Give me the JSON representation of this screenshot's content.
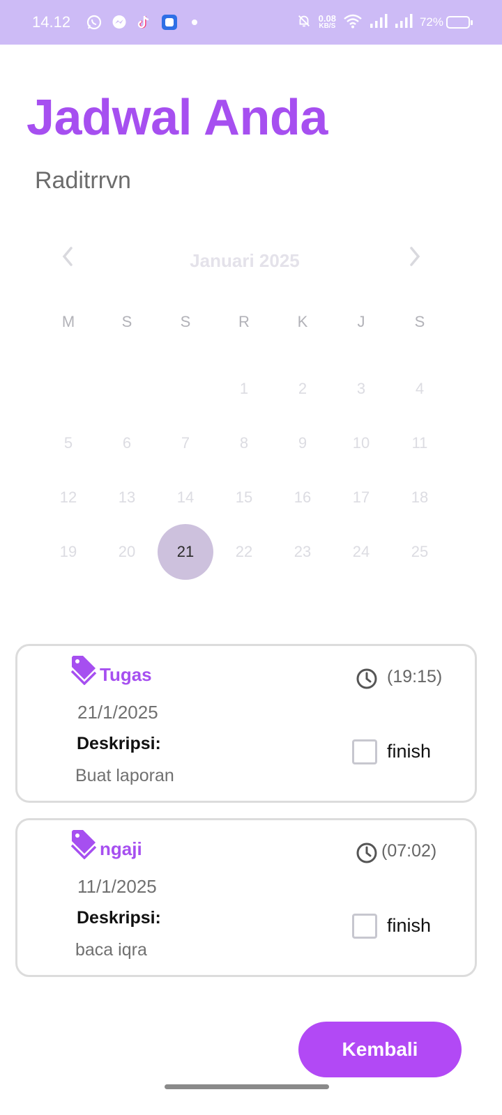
{
  "status_bar": {
    "time": "14.12",
    "app_icons": [
      "whatsapp-icon",
      "messenger-icon",
      "tiktok-icon",
      "app-icon",
      "dot-icon"
    ],
    "net_speed": "0.08",
    "net_unit": "KB/S",
    "battery": "72%",
    "battery_level": 0.72,
    "background": "#cdbbf6"
  },
  "header": {
    "title": "Jadwal Anda",
    "username": "Raditrrvn"
  },
  "calendar": {
    "month_label": "Januari 2025",
    "prev_icon": "chevron-left-icon",
    "next_icon": "chevron-right-icon",
    "weekdays": [
      "M",
      "S",
      "S",
      "R",
      "K",
      "J",
      "S"
    ],
    "leading_blanks": 3,
    "days": [
      "1",
      "2",
      "3",
      "4",
      "5",
      "6",
      "7",
      "8",
      "9",
      "10",
      "11",
      "12",
      "13",
      "14",
      "15",
      "16",
      "17",
      "18",
      "19",
      "20",
      "21",
      "22",
      "23",
      "24",
      "25"
    ],
    "selected_day": "21"
  },
  "schedules": [
    {
      "category": "Tugas",
      "date": "21/1/2025",
      "description_label": "Deskripsi:",
      "description": "Buat laporan",
      "time": "(19:15)",
      "finish_label": "finish",
      "finished": false
    },
    {
      "category": "ngaji",
      "date": "11/1/2025",
      "description_label": "Deskripsi:",
      "description": "baca iqra",
      "time": "(07:02)",
      "finish_label": "finish",
      "finished": false
    }
  ],
  "back_button_label": "Kembali",
  "colors": {
    "accent": "#a64ff0",
    "button": "#b249f5",
    "selected_day": "#cdc1dd"
  }
}
